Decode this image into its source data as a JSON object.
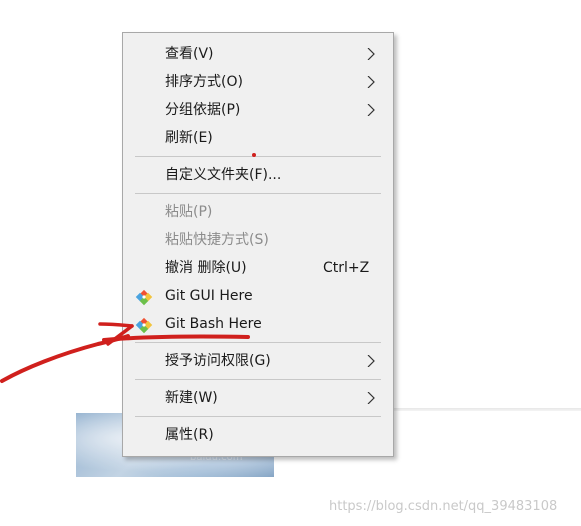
{
  "menu": {
    "view": "查看(V)",
    "sort": "排序方式(O)",
    "group": "分组依据(P)",
    "refresh": "刷新(E)",
    "customize": "自定义文件夹(F)...",
    "paste": "粘贴(P)",
    "paste_shortcut": "粘贴快捷方式(S)",
    "undo_delete": "撤消 删除(U)",
    "undo_shortcut": "Ctrl+Z",
    "git_gui": "Git GUI Here",
    "git_bash": "Git Bash Here",
    "grant_access": "授予访问权限(G)",
    "new": "新建(W)",
    "properties": "属性(R)"
  },
  "icons": {
    "submenu": "chevron-right-icon",
    "git": "git-icon"
  },
  "colors": {
    "annotation": "#d0201d",
    "menu_bg": "#f0f0f0",
    "disabled_text": "#8c8c8c"
  },
  "watermark": "https://blog.csdn.net/qq_39483108",
  "background": {
    "thumb_text": "baidu.com"
  }
}
